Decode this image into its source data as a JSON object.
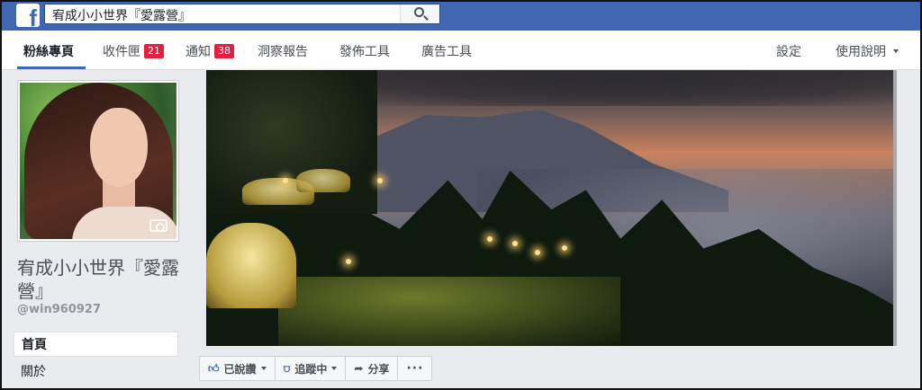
{
  "header": {
    "logo": "f",
    "search_value": "宥成小小世界『愛露營』"
  },
  "nav": {
    "items": [
      {
        "label": "粉絲專頁"
      },
      {
        "label": "收件匣",
        "badge": "21"
      },
      {
        "label": "通知",
        "badge": "38"
      },
      {
        "label": "洞察報告"
      },
      {
        "label": "發佈工具"
      },
      {
        "label": "廣告工具"
      }
    ],
    "settings": "設定",
    "help": "使用說明"
  },
  "sidebar": {
    "page_name": "宥成小小世界『愛露營』",
    "handle": "@win960927",
    "items": [
      {
        "label": "首頁"
      },
      {
        "label": "關於"
      }
    ]
  },
  "actions": [
    {
      "label": "已說讚",
      "icon": "thumbs-up-icon"
    },
    {
      "label": "追蹤中",
      "icon": "rss-icon"
    },
    {
      "label": "分享",
      "icon": "share-arrow-icon"
    },
    {
      "label": "···",
      "icon": "more-icon"
    }
  ],
  "colors": {
    "brand_blue": "#4267b2",
    "badge_red": "#e41e3f",
    "background": "#e9ebee"
  }
}
